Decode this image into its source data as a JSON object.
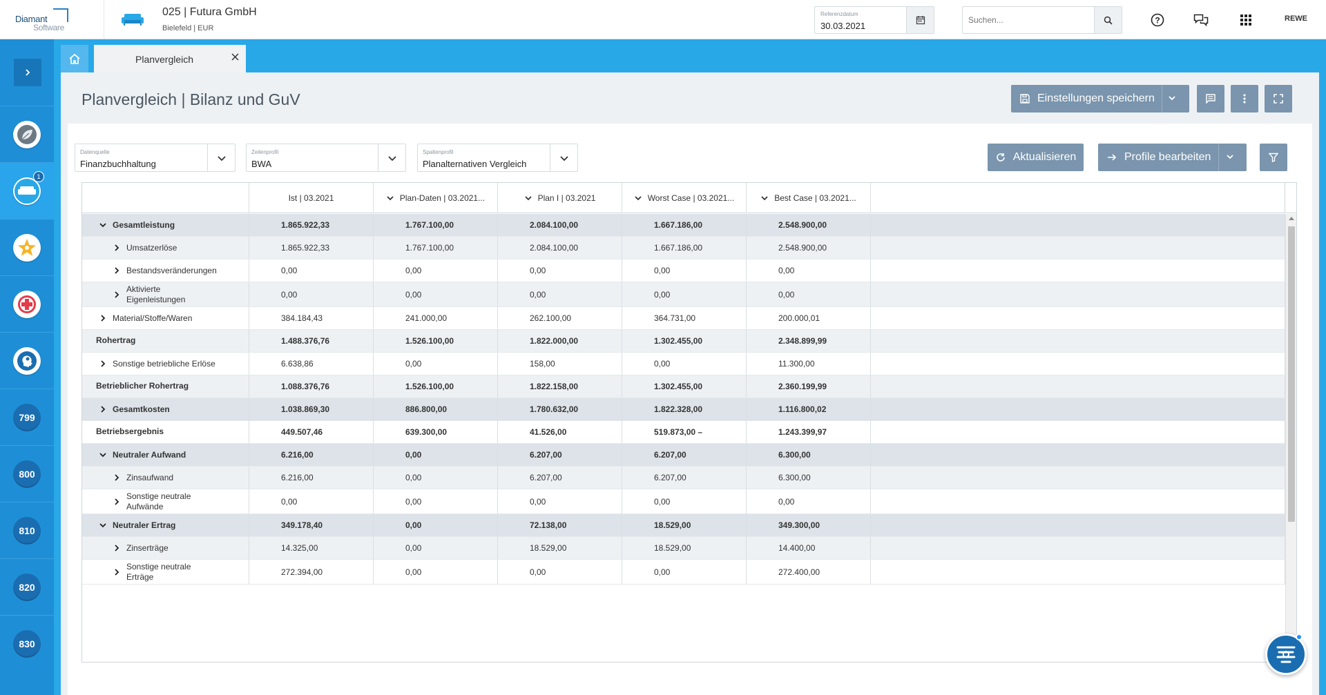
{
  "header": {
    "logo_line1": "Diamant",
    "logo_line2": "Software",
    "company": "025 | Futura GmbH",
    "company_sub": "Bielefeld | EUR",
    "refdate_label": "Referenzdatum",
    "refdate_value": "30.03.2021",
    "search_placeholder": "Suchen...",
    "user_initials": "REWE"
  },
  "sidebar": {
    "items": [
      {
        "name": "leaf",
        "badge": null
      },
      {
        "name": "sofa",
        "badge": "1"
      },
      {
        "name": "star",
        "badge": null
      },
      {
        "name": "medical-cross",
        "badge": null
      },
      {
        "name": "head-idea",
        "badge": null
      },
      {
        "name": "number",
        "label": "799"
      },
      {
        "name": "number",
        "label": "800"
      },
      {
        "name": "number",
        "label": "810"
      },
      {
        "name": "number",
        "label": "820"
      },
      {
        "name": "number",
        "label": "830"
      }
    ]
  },
  "tabs": [
    {
      "label": "Planvergleich",
      "active": true
    }
  ],
  "page": {
    "title": "Planvergleich | Bilanz und GuV",
    "save_settings": "Einstellungen speichern",
    "refresh": "Aktualisieren",
    "edit_profiles": "Profile bearbeiten"
  },
  "filters": {
    "datasource": {
      "label": "Datenquelle",
      "value": "Finanzbuchhaltung"
    },
    "rowprofile": {
      "label": "Zeilenprofil",
      "value": "BWA"
    },
    "colprofile": {
      "label": "Spaltenprofil",
      "value": "Planalternativen Vergleich"
    }
  },
  "table": {
    "columns": [
      "Ist | 03.2021",
      "Plan-Daten | 03.2021...",
      "Plan I | 03.2021",
      "Worst Case | 03.2021...",
      "Best Case | 03.2021..."
    ],
    "rows": [
      {
        "label": "Gesamtleistung",
        "indent": 1,
        "chevron": "down",
        "style": "grp",
        "bold": true,
        "values": [
          "1.865.922,33",
          "1.767.100,00",
          "2.084.100,00",
          "1.667.186,00",
          "2.548.900,00"
        ]
      },
      {
        "label": "Umsatzerlöse",
        "indent": 2,
        "chevron": "right",
        "style": "alt",
        "bold": false,
        "values": [
          "1.865.922,33",
          "1.767.100,00",
          "2.084.100,00",
          "1.667.186,00",
          "2.548.900,00"
        ]
      },
      {
        "label": "Bestandsveränderungen",
        "indent": 2,
        "chevron": "right",
        "style": "white",
        "bold": false,
        "values": [
          "0,00",
          "0,00",
          "0,00",
          "0,00",
          "0,00"
        ]
      },
      {
        "label": "Aktivierte Eigenleistungen",
        "indent": 2,
        "chevron": "right",
        "style": "alt",
        "bold": false,
        "values": [
          "0,00",
          "0,00",
          "0,00",
          "0,00",
          "0,00"
        ]
      },
      {
        "label": "Material/Stoffe/Waren",
        "indent": 1,
        "chevron": "right",
        "style": "white",
        "bold": false,
        "values": [
          "384.184,43",
          "241.000,00",
          "262.100,00",
          "364.731,00",
          "200.000,01"
        ]
      },
      {
        "label": "Rohertrag",
        "indent": 0,
        "chevron": null,
        "style": "alt",
        "bold": true,
        "values": [
          "1.488.376,76",
          "1.526.100,00",
          "1.822.000,00",
          "1.302.455,00",
          "2.348.899,99"
        ]
      },
      {
        "label": "Sonstige betriebliche Erlöse",
        "indent": 1,
        "chevron": "right",
        "style": "white",
        "bold": false,
        "values": [
          "6.638,86",
          "0,00",
          "158,00",
          "0,00",
          "11.300,00"
        ]
      },
      {
        "label": "Betrieblicher Rohertrag",
        "indent": 0,
        "chevron": null,
        "style": "alt",
        "bold": true,
        "values": [
          "1.088.376,76",
          "1.526.100,00",
          "1.822.158,00",
          "1.302.455,00",
          "2.360.199,99"
        ]
      },
      {
        "label": "Gesamtkosten",
        "indent": 1,
        "chevron": "right",
        "style": "grp",
        "bold": true,
        "values": [
          "1.038.869,30",
          "886.800,00",
          "1.780.632,00",
          "1.822.328,00",
          "1.116.800,02"
        ]
      },
      {
        "label": "Betriebsergebnis",
        "indent": 0,
        "chevron": null,
        "style": "white",
        "bold": true,
        "values": [
          "449.507,46",
          "639.300,00",
          "41.526,00",
          "519.873,00 –",
          "1.243.399,97"
        ]
      },
      {
        "label": "Neutraler Aufwand",
        "indent": 1,
        "chevron": "down",
        "style": "grp",
        "bold": true,
        "values": [
          "6.216,00",
          "0,00",
          "6.207,00",
          "6.207,00",
          "6.300,00"
        ]
      },
      {
        "label": "Zinsaufwand",
        "indent": 2,
        "chevron": "right",
        "style": "alt",
        "bold": false,
        "values": [
          "6.216,00",
          "0,00",
          "6.207,00",
          "6.207,00",
          "6.300,00"
        ]
      },
      {
        "label": "Sonstige neutrale Aufwände",
        "indent": 2,
        "chevron": "right",
        "style": "white",
        "bold": false,
        "values": [
          "0,00",
          "0,00",
          "0,00",
          "0,00",
          "0,00"
        ]
      },
      {
        "label": "Neutraler Ertrag",
        "indent": 1,
        "chevron": "down",
        "style": "grp",
        "bold": true,
        "values": [
          "349.178,40",
          "0,00",
          "72.138,00",
          "18.529,00",
          "349.300,00"
        ]
      },
      {
        "label": "Zinserträge",
        "indent": 2,
        "chevron": "right",
        "style": "alt",
        "bold": false,
        "values": [
          "14.325,00",
          "0,00",
          "18.529,00",
          "18.529,00",
          "14.400,00"
        ]
      },
      {
        "label": "Sonstige neutrale Erträge",
        "indent": 2,
        "chevron": "right",
        "style": "white",
        "bold": false,
        "values": [
          "272.394,00",
          "0,00",
          "0,00",
          "0,00",
          "272.400,00"
        ]
      }
    ]
  },
  "colors": {
    "primary": "#29a8e8",
    "sidebar": "#1e8fd6",
    "button": "#7a95ad",
    "group_row": "#dde3e8"
  }
}
